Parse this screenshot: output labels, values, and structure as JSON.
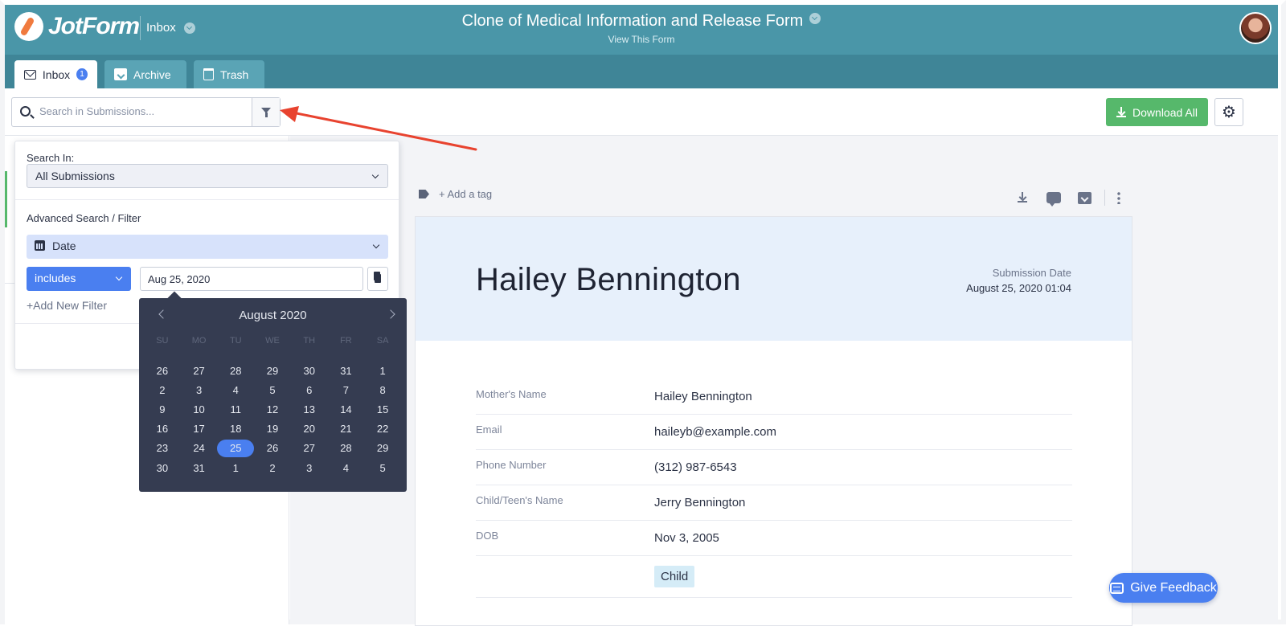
{
  "header": {
    "logo_text": "JotForm",
    "inbox_label": "Inbox",
    "form_title": "Clone of Medical Information and Release Form",
    "view_form": "View This Form"
  },
  "tabs": [
    {
      "label": "Inbox",
      "badge": "1",
      "icon": "mail-icon",
      "active": true
    },
    {
      "label": "Archive",
      "icon": "archive-icon",
      "active": false
    },
    {
      "label": "Trash",
      "icon": "trash-icon",
      "active": false
    }
  ],
  "search": {
    "placeholder": "Search in Submissions..."
  },
  "toolbar": {
    "download_all": "Download All"
  },
  "filter_panel": {
    "search_in_label": "Search In:",
    "search_in_value": "All Submissions",
    "advanced_label": "Advanced Search / Filter",
    "field_value": "Date",
    "operator_value": "includes",
    "date_value": "Aug 25, 2020",
    "add_filter": "+Add New Filter"
  },
  "calendar": {
    "month_label": "August 2020",
    "weekdays": [
      "SU",
      "MO",
      "TU",
      "WE",
      "TH",
      "FR",
      "SA"
    ],
    "days": [
      26,
      27,
      28,
      29,
      30,
      31,
      1,
      2,
      3,
      4,
      5,
      6,
      7,
      8,
      9,
      10,
      11,
      12,
      13,
      14,
      15,
      16,
      17,
      18,
      19,
      20,
      21,
      22,
      23,
      24,
      25,
      26,
      27,
      28,
      29,
      30,
      31,
      1,
      2,
      3,
      4,
      5
    ],
    "selected_index": 30
  },
  "submission": {
    "add_tag": "+ Add a tag",
    "name": "Hailey Bennington",
    "date_label": "Submission Date",
    "date_value": "August 25, 2020 01:04",
    "fields": [
      {
        "label": "Mother's Name",
        "value": "Hailey Bennington"
      },
      {
        "label": "Email",
        "value": "haileyb@example.com"
      },
      {
        "label": "Phone Number",
        "value": "(312) 987-6543"
      },
      {
        "label": "Child/Teen's Name",
        "value": "Jerry Bennington"
      },
      {
        "label": "DOB",
        "value": "Nov 3, 2005"
      }
    ],
    "chip": "Child"
  },
  "feedback": {
    "label": "Give Feedback"
  },
  "colors": {
    "header": "#4a96a8",
    "accent_blue": "#4a7ff0",
    "download_green": "#56b86b",
    "annotation_arrow": "#e8432f",
    "calendar_bg": "#353c51"
  }
}
